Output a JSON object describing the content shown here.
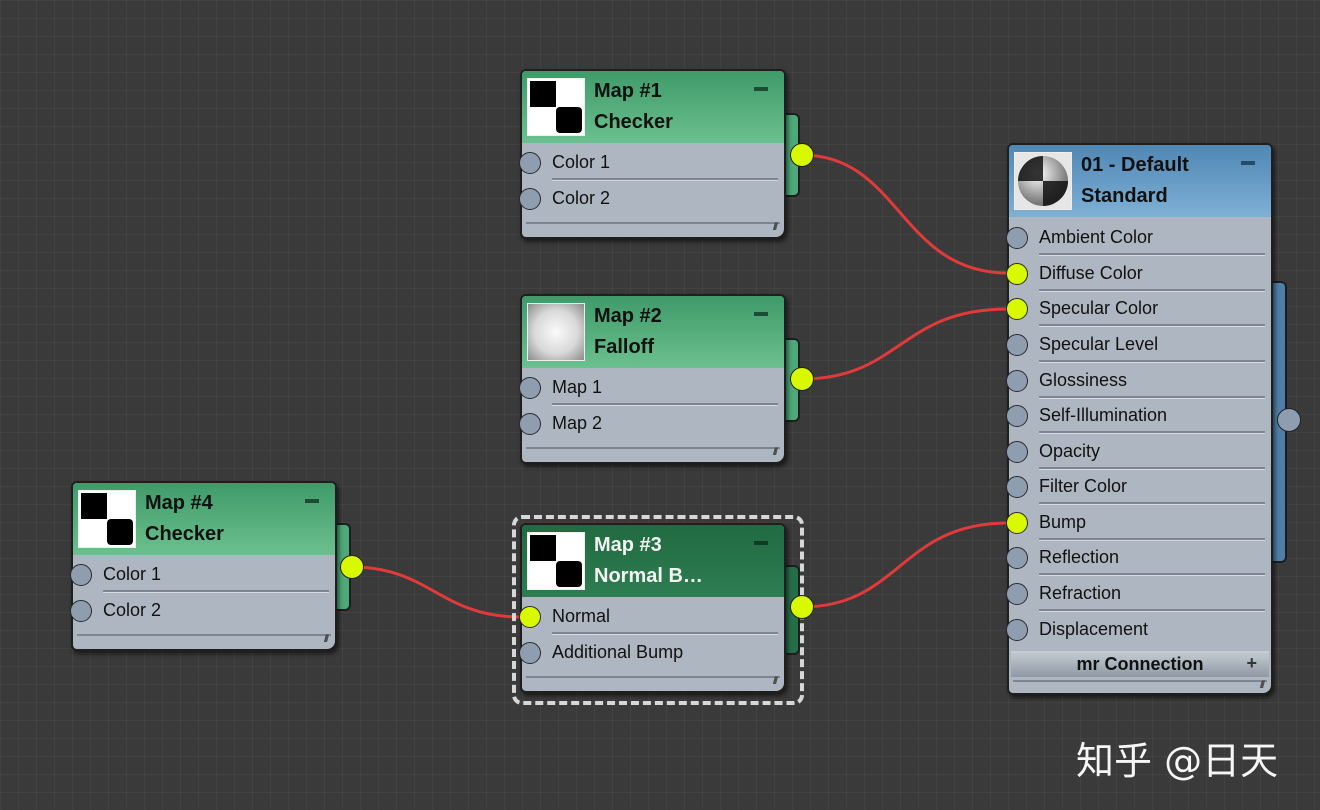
{
  "nodes": {
    "map1": {
      "line1": "Map #1",
      "line2": "Checker",
      "slots": [
        "Color 1",
        "Color 2"
      ],
      "thumbnail": "checker-icon"
    },
    "map2": {
      "line1": "Map #2",
      "line2": "Falloff",
      "slots": [
        "Map 1",
        "Map 2"
      ],
      "thumbnail": "falloff-gradient-icon"
    },
    "map3": {
      "line1": "Map #3",
      "line2": "Normal  B…",
      "slots": [
        "Normal",
        "Additional Bump"
      ],
      "thumbnail": "checker-icon",
      "selected": true
    },
    "map4": {
      "line1": "Map #4",
      "line2": "Checker",
      "slots": [
        "Color 1",
        "Color 2"
      ],
      "thumbnail": "checker-icon"
    },
    "material": {
      "line1": "01 - Default",
      "line2": "Standard",
      "thumbnail": "material-sphere-icon",
      "slots": [
        "Ambient Color",
        "Diffuse Color",
        "Specular Color",
        "Specular Level",
        "Glossiness",
        "Self-Illumination",
        "Opacity",
        "Filter Color",
        "Bump",
        "Reflection",
        "Refraction",
        "Displacement"
      ],
      "group_label": "mr Connection",
      "group_toggle": "+"
    }
  },
  "connections": [
    {
      "from": "Map #1",
      "to": "Diffuse Color"
    },
    {
      "from": "Map #2",
      "to": "Specular Color"
    },
    {
      "from": "Map #4",
      "to": "Normal"
    },
    {
      "from": "Map #3",
      "to": "Bump"
    }
  ],
  "watermark": "知乎 @日天",
  "colors": {
    "canvas": "#3a3a3a",
    "map_header": "#4ea877",
    "selected_header": "#256f48",
    "material_header": "#5f96c2",
    "node_body": "#aeb7c1",
    "active_socket": "#d8f900",
    "inactive_socket": "#8f9db0",
    "wire": "#e03a3a"
  }
}
